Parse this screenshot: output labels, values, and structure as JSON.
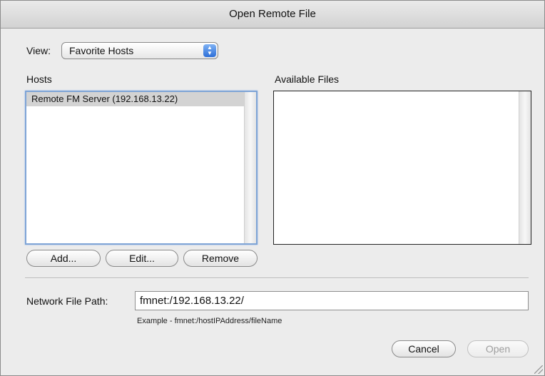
{
  "window": {
    "title": "Open Remote File"
  },
  "view": {
    "label": "View:",
    "selected": "Favorite Hosts"
  },
  "hosts": {
    "header": "Hosts",
    "items": [
      "Remote FM Server (192.168.13.22)"
    ]
  },
  "files": {
    "header": "Available Files",
    "items": []
  },
  "buttons": {
    "add": "Add...",
    "edit": "Edit...",
    "remove": "Remove",
    "cancel": "Cancel",
    "open": "Open"
  },
  "path": {
    "label": "Network File Path:",
    "value": "fmnet:/192.168.13.22/",
    "example": "Example - fmnet:/hostIPAddress/fileName"
  },
  "colors": {
    "selection_inactive": "#d3d3d3",
    "focus_ring": "#7ea4d6",
    "popup_arrow": "#3b7be0"
  }
}
